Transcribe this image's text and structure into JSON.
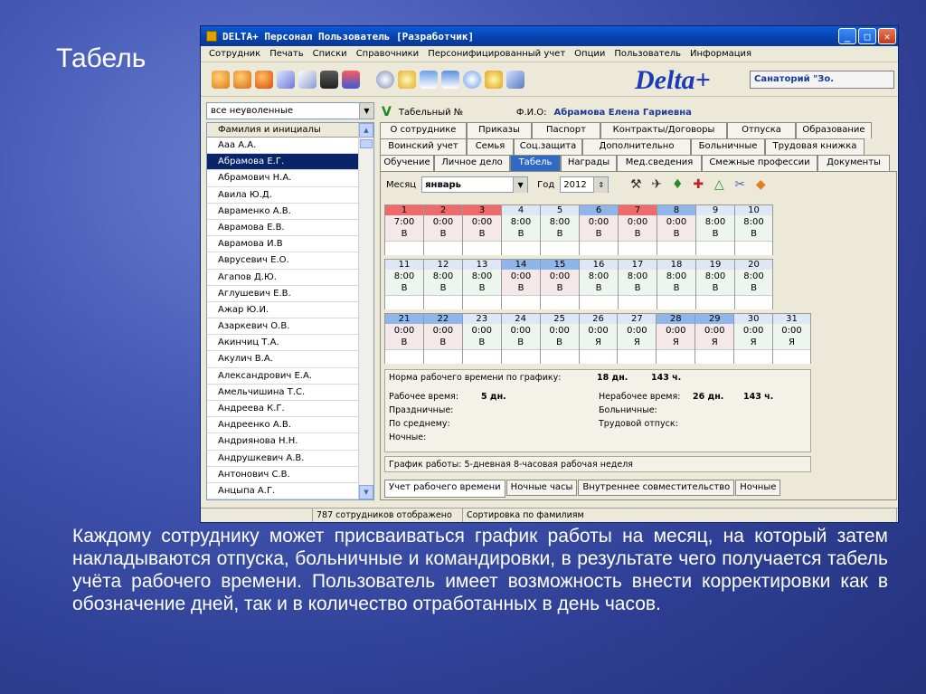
{
  "slide": {
    "title": "Табель",
    "caption": "Каждому сотруднику может присваиваться график работы на месяц, на который затем накладываются отпуска, больничные и командировки, в результате чего получается табель учёта рабочего времени. Пользователь имеет возможность внести корректировки как в обозначение дней, так и в количество отработанных в день часов."
  },
  "window": {
    "title": "DELTA+ Персонал   Пользователь [Разработчик]",
    "buttons": {
      "minimize": "_",
      "maximize": "□",
      "close": "✕"
    }
  },
  "menu": [
    "Сотрудник",
    "Печать",
    "Списки",
    "Справочники",
    "Персонифицированный учет",
    "Опции",
    "Пользователь",
    "Информация"
  ],
  "toolbar": {
    "logo": "Delta+",
    "org": "Санаторий \"Зо."
  },
  "left": {
    "filter": "все неуволенные",
    "header": "Фамилия и инициалы",
    "employees": [
      "Ааа А.А.",
      "Абрамова Е.Г.",
      "Абрамович Н.А.",
      "Авила Ю.Д.",
      "Авраменко А.В.",
      "Аврамова Е.В.",
      "Аврамова И.В",
      "Аврусевич Е.О.",
      "Агапов Д.Ю.",
      "Аглушевич Е.В.",
      "Ажар Ю.И.",
      "Азаркевич О.В.",
      "Акинчиц Т.А.",
      "Акулич В.А.",
      "Александрович Е.А.",
      "Амельчишина Т.С.",
      "Андреева К.Г.",
      "Андреенко А.В.",
      "Андриянова Н.Н.",
      "Андрушкевич А.В.",
      "Антонович С.В.",
      "Анцыпа А.Г."
    ],
    "selected_index": 1
  },
  "identity": {
    "check": "V",
    "tabnum_label": "Табельный №",
    "fio_label": "Ф.И.О:",
    "fio_value": "Абрамова Елена Гариевна"
  },
  "tabs": {
    "row1": [
      "О сотруднике",
      "Приказы",
      "Паспорт",
      "Контракты/Договоры",
      "Отпуска",
      "Образование"
    ],
    "row2": [
      "Воинский учет",
      "Семья",
      "Соц.защита",
      "Дополнительно",
      "Больничные",
      "Трудовая книжка"
    ],
    "row3": [
      "Обучение",
      "Личное дело",
      "Табель",
      "Награды",
      "Мед.сведения",
      "Смежные профессии",
      "Документы"
    ],
    "active": "Табель"
  },
  "timesheet": {
    "month_label": "Месяц",
    "month": "январь",
    "year_label": "Год",
    "year": "2012",
    "days": [
      {
        "n": "1",
        "h": "7:00",
        "c": "В",
        "t": "hol"
      },
      {
        "n": "2",
        "h": "0:00",
        "c": "В",
        "t": "hol"
      },
      {
        "n": "3",
        "h": "0:00",
        "c": "В",
        "t": "hol"
      },
      {
        "n": "4",
        "h": "8:00",
        "c": "В",
        "t": "wk"
      },
      {
        "n": "5",
        "h": "8:00",
        "c": "В",
        "t": "wk"
      },
      {
        "n": "6",
        "h": "0:00",
        "c": "В",
        "t": "wknd"
      },
      {
        "n": "7",
        "h": "0:00",
        "c": "В",
        "t": "hol"
      },
      {
        "n": "8",
        "h": "0:00",
        "c": "В",
        "t": "wknd"
      },
      {
        "n": "9",
        "h": "8:00",
        "c": "В",
        "t": "wk"
      },
      {
        "n": "10",
        "h": "8:00",
        "c": "В",
        "t": "wk"
      },
      {
        "n": "11",
        "h": "8:00",
        "c": "В",
        "t": "wk"
      },
      {
        "n": "12",
        "h": "8:00",
        "c": "В",
        "t": "wk"
      },
      {
        "n": "13",
        "h": "8:00",
        "c": "В",
        "t": "wk"
      },
      {
        "n": "14",
        "h": "0:00",
        "c": "В",
        "t": "wknd"
      },
      {
        "n": "15",
        "h": "0:00",
        "c": "В",
        "t": "wknd"
      },
      {
        "n": "16",
        "h": "8:00",
        "c": "В",
        "t": "wk"
      },
      {
        "n": "17",
        "h": "8:00",
        "c": "В",
        "t": "wk"
      },
      {
        "n": "18",
        "h": "8:00",
        "c": "В",
        "t": "wk"
      },
      {
        "n": "19",
        "h": "8:00",
        "c": "В",
        "t": "wk"
      },
      {
        "n": "20",
        "h": "8:00",
        "c": "В",
        "t": "wk"
      },
      {
        "n": "21",
        "h": "0:00",
        "c": "В",
        "t": "wknd"
      },
      {
        "n": "22",
        "h": "0:00",
        "c": "В",
        "t": "wknd"
      },
      {
        "n": "23",
        "h": "0:00",
        "c": "В",
        "t": "wk"
      },
      {
        "n": "24",
        "h": "0:00",
        "c": "В",
        "t": "wk"
      },
      {
        "n": "25",
        "h": "0:00",
        "c": "В",
        "t": "wk"
      },
      {
        "n": "26",
        "h": "0:00",
        "c": "Я",
        "t": "wk"
      },
      {
        "n": "27",
        "h": "0:00",
        "c": "Я",
        "t": "wk"
      },
      {
        "n": "28",
        "h": "0:00",
        "c": "Я",
        "t": "wknd"
      },
      {
        "n": "29",
        "h": "0:00",
        "c": "Я",
        "t": "wknd"
      },
      {
        "n": "30",
        "h": "0:00",
        "c": "Я",
        "t": "wk"
      },
      {
        "n": "31",
        "h": "0:00",
        "c": "Я",
        "t": "wk"
      }
    ],
    "summary": {
      "norm_label": "Норма рабочего времени по графику:",
      "norm_days": "18 дн.",
      "norm_hours": "143 ч.",
      "work_label": "Рабочее время:",
      "work_days": "5 дн.",
      "nonwork_label": "Нерабочее время:",
      "nonwork_days": "26 дн.",
      "nonwork_hours": "143 ч.",
      "holidays_label": "Праздничные:",
      "sick_label": "Больничные:",
      "average_label": "По среднему:",
      "leave_label": "Трудовой отпуск:",
      "night_label": "Ночные:"
    },
    "schedule": "График работы: 5-дневная 8-часовая рабочая неделя",
    "bottom_tabs": [
      "Учет рабочего времени",
      "Ночные часы",
      "Внутреннее совместительство",
      "Ночные"
    ]
  },
  "status": {
    "count": "787 сотрудников отображено",
    "sort": "Сортировка по фамилиям"
  }
}
